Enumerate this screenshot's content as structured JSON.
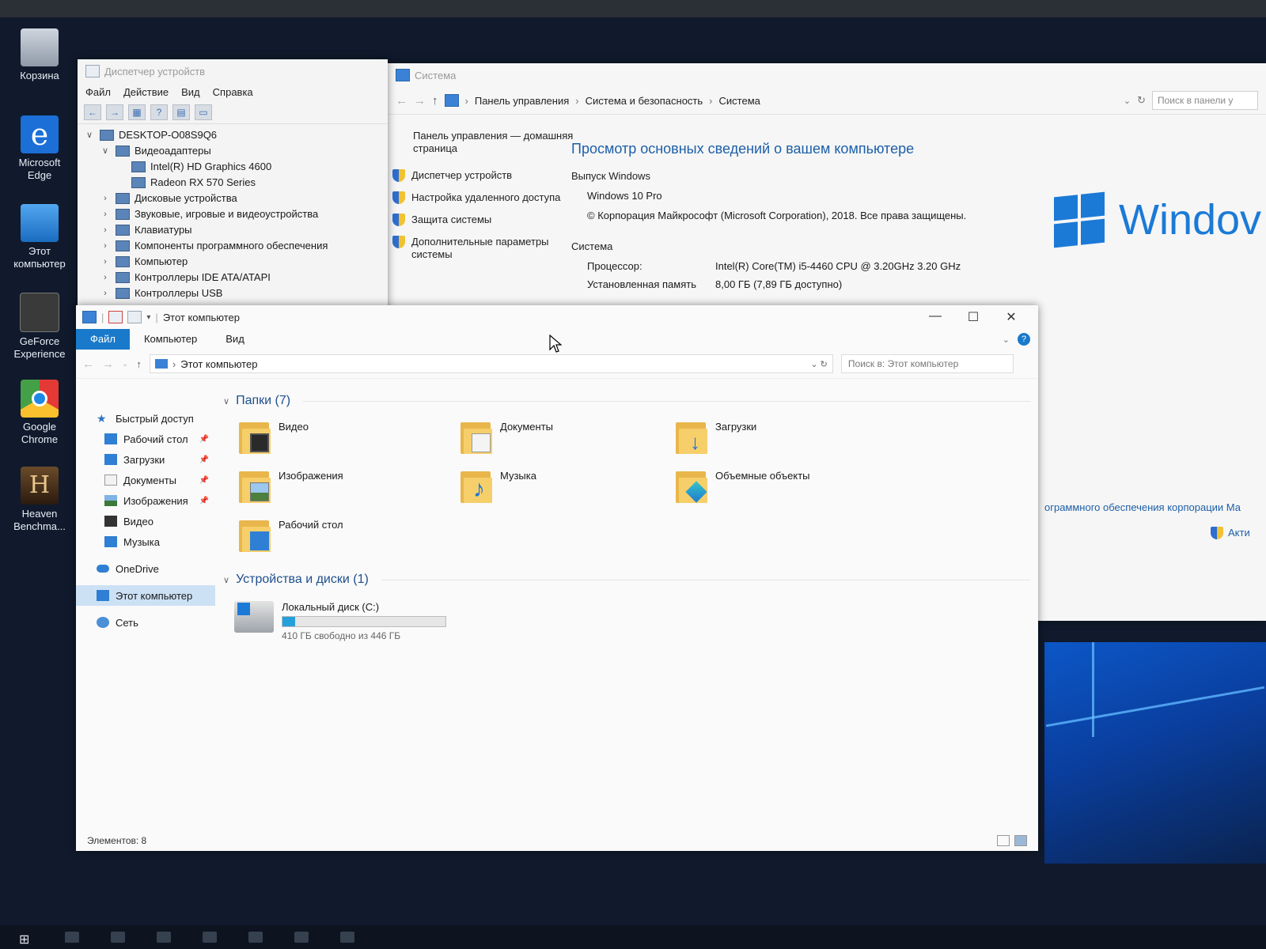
{
  "desktop": {
    "icons": [
      {
        "label": "Корзина",
        "icon": "recycle-bin-icon"
      },
      {
        "label": "Microsoft Edge",
        "icon": "edge-icon"
      },
      {
        "label": "Этот компьютер",
        "icon": "this-pc-icon"
      },
      {
        "label": "GeForce Experience",
        "icon": "geforce-icon"
      },
      {
        "label": "Google Chrome",
        "icon": "chrome-icon"
      },
      {
        "label": "Heaven Benchma...",
        "icon": "heaven-icon"
      }
    ]
  },
  "devmgr": {
    "title": "Диспетчер устройств",
    "menu": [
      "Файл",
      "Действие",
      "Вид",
      "Справка"
    ],
    "tree": [
      {
        "label": "DESKTOP-O08S9Q6",
        "level": 0,
        "expanded": true
      },
      {
        "label": "Видеоадаптеры",
        "level": 1,
        "expanded": true
      },
      {
        "label": "Intel(R) HD Graphics 4600",
        "level": 2
      },
      {
        "label": "Radeon RX 570 Series",
        "level": 2
      },
      {
        "label": "Дисковые устройства",
        "level": 1
      },
      {
        "label": "Звуковые, игровые и видеоустройства",
        "level": 1
      },
      {
        "label": "Клавиатуры",
        "level": 1
      },
      {
        "label": "Компоненты программного обеспечения",
        "level": 1
      },
      {
        "label": "Компьютер",
        "level": 1
      },
      {
        "label": "Контроллеры IDE ATA/ATAPI",
        "level": 1
      },
      {
        "label": "Контроллеры USB",
        "level": 1
      }
    ]
  },
  "system": {
    "title": "Система",
    "breadcrumb": [
      "Панель управления",
      "Система и безопасность",
      "Система"
    ],
    "search_placeholder": "Поиск в панели у",
    "left_home": "Панель управления — домашняя страница",
    "left_links": [
      "Диспетчер устройств",
      "Настройка удаленного доступа",
      "Защита системы",
      "Дополнительные параметры системы"
    ],
    "heading": "Просмотр основных сведений о вашем компьютере",
    "edition_section": "Выпуск Windows",
    "edition": "Windows 10 Pro",
    "copyright": "© Корпорация Майкрософт (Microsoft Corporation), 2018. Все права защищены.",
    "system_section": "Система",
    "specs": [
      {
        "key": "Процессор:",
        "value": "Intel(R) Core(TM) i5-4460  CPU @ 3.20GHz   3.20 GHz"
      },
      {
        "key": "Установленная память",
        "value": "8,00 ГБ (7,89 ГБ доступно)"
      }
    ],
    "logo_text": "Windov",
    "footer_link": "ограммного обеспечения корпорации Ма",
    "activate": "Акти"
  },
  "explorer": {
    "title": "Этот компьютер",
    "ribbon_tabs": [
      "Файл",
      "Компьютер",
      "Вид"
    ],
    "path": "Этот компьютер",
    "search_placeholder": "Поиск в: Этот компьютер",
    "nav": [
      {
        "label": "Быстрый доступ",
        "icon": "star",
        "kind": "top"
      },
      {
        "label": "Рабочий стол",
        "icon": "blue",
        "pinned": true
      },
      {
        "label": "Загрузки",
        "icon": "blue",
        "pinned": true
      },
      {
        "label": "Документы",
        "icon": "doc",
        "pinned": true
      },
      {
        "label": "Изображения",
        "icon": "img",
        "pinned": true
      },
      {
        "label": "Видео",
        "icon": "vid"
      },
      {
        "label": "Музыка",
        "icon": "blue"
      },
      {
        "label": "OneDrive",
        "icon": "cloud",
        "kind": "top"
      },
      {
        "label": "Этот компьютер",
        "icon": "blue",
        "kind": "top",
        "selected": true
      },
      {
        "label": "Сеть",
        "icon": "net",
        "kind": "top"
      }
    ],
    "folders_group": "Папки (7)",
    "folders": [
      {
        "label": "Видео",
        "badge": "b-video",
        "icon": "video-folder-icon"
      },
      {
        "label": "Документы",
        "badge": "b-doc",
        "icon": "documents-folder-icon"
      },
      {
        "label": "Загрузки",
        "badge": "b-dl",
        "icon": "downloads-folder-icon"
      },
      {
        "label": "Изображения",
        "badge": "b-img",
        "icon": "pictures-folder-icon"
      },
      {
        "label": "Музыка",
        "badge": "b-music",
        "icon": "music-folder-icon"
      },
      {
        "label": "Объемные объекты",
        "badge": "b-3d",
        "icon": "3d-objects-folder-icon"
      },
      {
        "label": "Рабочий стол",
        "badge": "b-desk",
        "icon": "desktop-folder-icon"
      }
    ],
    "drives_group": "Устройства и диски (1)",
    "drive": {
      "label": "Локальный диск (C:)",
      "free_text": "410 ГБ свободно из 446 ГБ",
      "used_fraction": 0.08
    },
    "status": "Элементов: 8"
  },
  "colors": {
    "accent": "#1979ca",
    "usage_bar": "#26a0da"
  }
}
